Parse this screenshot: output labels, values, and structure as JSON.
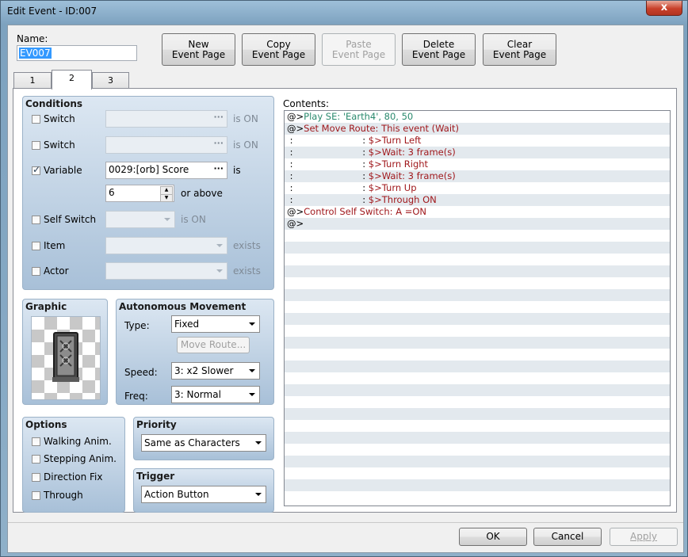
{
  "window": {
    "title": "Edit Event - ID:007",
    "close_glyph": "x"
  },
  "name": {
    "label": "Name:",
    "value": "EV007"
  },
  "toolbar": {
    "new_page": [
      "New",
      "Event Page"
    ],
    "copy_page": [
      "Copy",
      "Event Page"
    ],
    "paste_page": [
      "Paste",
      "Event Page"
    ],
    "delete_page": [
      "Delete",
      "Event Page"
    ],
    "clear_page": [
      "Clear",
      "Event Page"
    ]
  },
  "tabs": [
    {
      "label": "1"
    },
    {
      "label": "2",
      "active": true
    },
    {
      "label": "3"
    }
  ],
  "conditions": {
    "title": "Conditions",
    "switch1": {
      "label": "Switch",
      "checked": false,
      "value": "",
      "suffix": "is ON"
    },
    "switch2": {
      "label": "Switch",
      "checked": false,
      "value": "",
      "suffix": "is ON"
    },
    "variable": {
      "label": "Variable",
      "checked": true,
      "value": "0029:[orb] Score",
      "suffix": "is",
      "number": "6",
      "number_suffix": "or above"
    },
    "self_switch": {
      "label": "Self Switch",
      "checked": false,
      "value": "",
      "suffix": "is ON"
    },
    "item": {
      "label": "Item",
      "checked": false,
      "value": "",
      "suffix": "exists"
    },
    "actor": {
      "label": "Actor",
      "checked": false,
      "value": "",
      "suffix": "exists"
    }
  },
  "graphic": {
    "title": "Graphic"
  },
  "autonomous": {
    "title": "Autonomous Movement",
    "type_label": "Type:",
    "type_value": "Fixed",
    "move_route": "Move Route...",
    "speed_label": "Speed:",
    "speed_value": "3: x2 Slower",
    "freq_label": "Freq:",
    "freq_value": "3: Normal"
  },
  "options": {
    "title": "Options",
    "walking": {
      "label": "Walking Anim.",
      "checked": false
    },
    "stepping": {
      "label": "Stepping Anim.",
      "checked": false
    },
    "direction_fix": {
      "label": "Direction Fix",
      "checked": false
    },
    "through": {
      "label": "Through",
      "checked": false
    }
  },
  "priority": {
    "title": "Priority",
    "value": "Same as Characters"
  },
  "trigger": {
    "title": "Trigger",
    "value": "Action Button"
  },
  "contents": {
    "label": "Contents:",
    "lines": [
      {
        "prefix": "@>",
        "text": "Play SE: 'Earth4', 80, 50",
        "color": "#2a8a6e"
      },
      {
        "prefix": "@>",
        "text": "Set Move Route: This event (Wait)",
        "color": "#a0181c"
      },
      {
        "prefix": " :                        : ",
        "text": "$>Turn Left",
        "color": "#a0181c"
      },
      {
        "prefix": " :                        : ",
        "text": "$>Wait: 3 frame(s)",
        "color": "#a0181c"
      },
      {
        "prefix": " :                        : ",
        "text": "$>Turn Right",
        "color": "#a0181c"
      },
      {
        "prefix": " :                        : ",
        "text": "$>Wait: 3 frame(s)",
        "color": "#a0181c"
      },
      {
        "prefix": " :                        : ",
        "text": "$>Turn Up",
        "color": "#a0181c"
      },
      {
        "prefix": " :                        : ",
        "text": "$>Through ON",
        "color": "#a0181c"
      },
      {
        "prefix": "@>",
        "text": "Control Self Switch: A =ON",
        "color": "#a0181c"
      },
      {
        "prefix": "@>",
        "text": "",
        "color": "#a0181c"
      }
    ]
  },
  "footer": {
    "ok": "OK",
    "cancel": "Cancel",
    "apply": "Apply"
  }
}
